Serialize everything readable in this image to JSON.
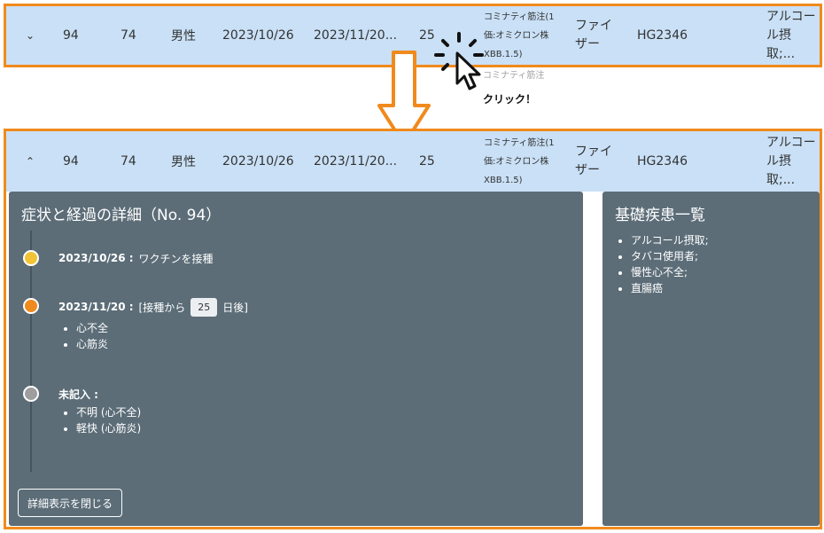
{
  "row": {
    "collapsed_chevron": "⌄",
    "expanded_chevron": "⌃",
    "no": "94",
    "age": "74",
    "sex": "男性",
    "vaccination_date": "2023/10/26",
    "onset_date": "2023/11/20...",
    "days": "25",
    "vaccine": "コミナティ筋注(1価:オミクロン株XBB.1.5)",
    "maker": "ファイザー",
    "lot": "HG2346",
    "conditions_short": "アルコール摂取;..."
  },
  "annotation": {
    "click_label": "クリック！",
    "ghost_text": "コミナティ筋注"
  },
  "detail": {
    "title": "症状と経過の詳細（No. 94）",
    "events": [
      {
        "date": "2023/10/26 :",
        "text": "ワクチンを接種",
        "color": "#f2c335"
      },
      {
        "date": "2023/11/20 :",
        "prefix": "[接種から",
        "days": "25",
        "suffix": "日後]",
        "items": [
          "心不全",
          "心筋炎"
        ],
        "color": "#f08a1c"
      },
      {
        "date": "未記入 :",
        "items": [
          "不明 (心不全)",
          "軽快 (心筋炎)"
        ],
        "color": "#9e9e9e"
      }
    ],
    "close_label": "詳細表示を閉じる"
  },
  "conditions": {
    "title": "基礎疾患一覧",
    "items": [
      "アルコール摂取;",
      "タバコ使用者;",
      "慢性心不全;",
      "直腸癌"
    ]
  },
  "colors": {
    "accent": "#f08a1c",
    "row_bg": "#c9e0f6",
    "panel_bg": "#5c6d78"
  }
}
